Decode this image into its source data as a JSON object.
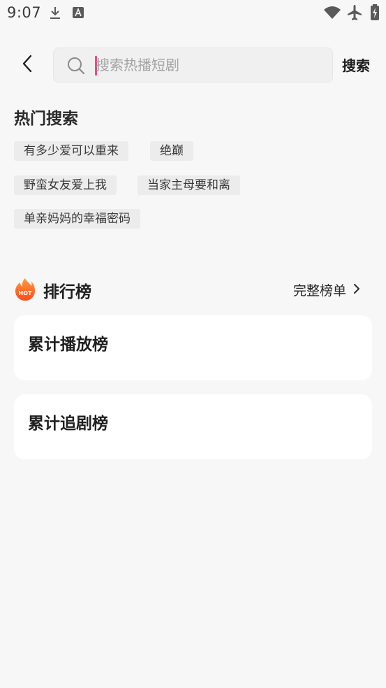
{
  "status_bar": {
    "time": "9:07",
    "icons": [
      "download-icon",
      "text-a-icon",
      "wifi-icon",
      "airplane-icon",
      "battery-charging-icon"
    ]
  },
  "header": {
    "back_icon": "chevron-left-icon",
    "search_placeholder": "搜索热播短剧",
    "search_value": "",
    "search_button": "搜索"
  },
  "hot_search": {
    "title": "热门搜索",
    "tags": [
      "有多少爱可以重来",
      "绝巅",
      "野蛮女友爱上我",
      "当家主母要和离",
      "单亲妈妈的幸福密码"
    ]
  },
  "ranking": {
    "badge_text": "HOT",
    "title": "排行榜",
    "more_label": "完整榜单",
    "boards": [
      {
        "title": "累计播放榜"
      },
      {
        "title": "累计追剧榜"
      }
    ]
  },
  "colors": {
    "background": "#f7f7f7",
    "caret": "#f0487a",
    "hot_badge": "#ff5a1f"
  }
}
